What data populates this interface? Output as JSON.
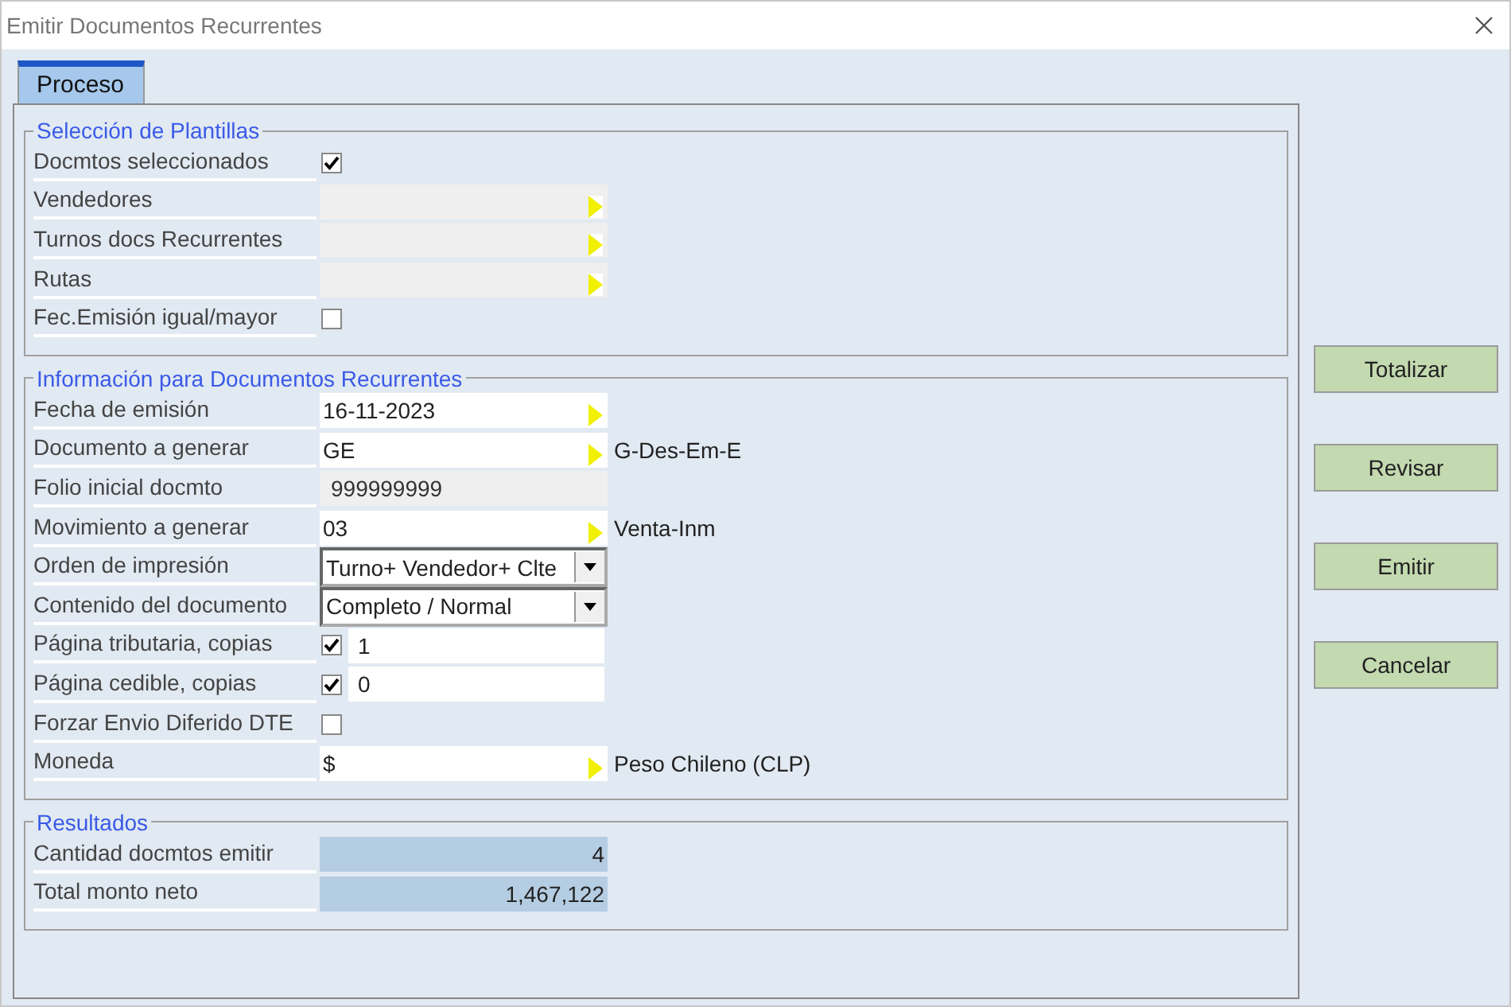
{
  "window": {
    "title": "Emitir Documentos Recurrentes"
  },
  "tabs": [
    {
      "label": "Proceso",
      "selected": true
    }
  ],
  "groups": [
    {
      "title": "Selección de Plantillas",
      "rows": [
        {
          "kind": "checkbox",
          "label": "Docmtos seleccionados",
          "checked": true
        },
        {
          "kind": "lookup",
          "label": "Vendedores",
          "disabled": true
        },
        {
          "kind": "lookup",
          "label": "Turnos docs Recurrentes",
          "disabled": true
        },
        {
          "kind": "lookup",
          "label": "Rutas",
          "disabled": true
        },
        {
          "kind": "checkbox",
          "label": "Fec.Emisión igual/mayor",
          "checked": false
        }
      ]
    },
    {
      "title": "Información para Documentos Recurrentes",
      "rows": [
        {
          "kind": "lookup",
          "label": "Fecha de emisión",
          "value": "16-11-2023",
          "disabled": false
        },
        {
          "kind": "lookup",
          "label": "Documento a generar",
          "value": "GE",
          "disabled": false,
          "note": "G-Des-Em-E"
        },
        {
          "kind": "readonly",
          "label": "Folio inicial docmto",
          "value": "999999999"
        },
        {
          "kind": "lookup",
          "label": "Movimiento a generar",
          "value": "03",
          "disabled": false,
          "note": "Venta-Inm"
        },
        {
          "kind": "dropdown",
          "label": "Orden de impresión",
          "value": "Turno+ Vendedor+ Clte"
        },
        {
          "kind": "dropdown",
          "label": "Contenido del documento",
          "value": "Completo / Normal"
        },
        {
          "kind": "check_input",
          "label": "Página tributaria, copias",
          "checked": true,
          "value": "1"
        },
        {
          "kind": "check_input",
          "label": "Página cedible, copias",
          "checked": true,
          "value": "0"
        },
        {
          "kind": "checkbox",
          "label": "Forzar Envio Diferido DTE",
          "checked": false
        },
        {
          "kind": "lookup",
          "label": "Moneda",
          "value": "$",
          "disabled": false,
          "note": "Peso Chileno (CLP)"
        }
      ]
    },
    {
      "title": "Resultados",
      "rows": [
        {
          "kind": "total",
          "label": "Cantidad docmtos emitir",
          "value": "4"
        },
        {
          "kind": "total",
          "label": "Total monto neto",
          "value": "1,467,122"
        }
      ]
    }
  ],
  "buttons": [
    "Totalizar",
    "Revisar",
    "Emitir",
    "Cancelar"
  ]
}
